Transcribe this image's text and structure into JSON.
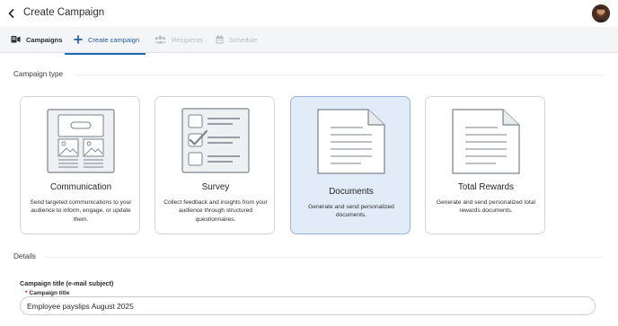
{
  "header": {
    "title": "Create Campaign",
    "back_icon": "chevron-left-icon",
    "avatar_icon": "user-avatar"
  },
  "tabs": [
    {
      "label": "Campaigns",
      "icon": "campaigns-icon",
      "state": "default"
    },
    {
      "label": "Create campaign",
      "icon": "plus-icon",
      "state": "active"
    },
    {
      "label": "Recipients",
      "icon": "users-icon",
      "state": "disabled"
    },
    {
      "label": "Schedule",
      "icon": "calendar-icon",
      "state": "disabled"
    }
  ],
  "campaign_type": {
    "label": "Campaign type",
    "cards": [
      {
        "title": "Communication",
        "description": "Send targeted communications to your audience to inform, engage, or update them.",
        "icon": "communication-layout-icon",
        "selected": false
      },
      {
        "title": "Survey",
        "description": "Collect feedback and insights from your audience through structured questionnaires.",
        "icon": "survey-checklist-icon",
        "selected": false
      },
      {
        "title": "Documents",
        "description": "Generate and send personalized documents.",
        "icon": "document-icon",
        "selected": true
      },
      {
        "title": "Total Rewards",
        "description": "Generate and send personalized total rewards documents.",
        "icon": "document-icon",
        "selected": false
      }
    ]
  },
  "details": {
    "label": "Details",
    "heading": "Campaign title (e-mail subject)",
    "field_label": "Campaign title",
    "required_mark": "*",
    "field_value": "Employee payslips August 2025"
  },
  "colors": {
    "accent": "#1f67b0",
    "selected_card_bg": "#e1ecf8",
    "required": "#d0021b"
  }
}
